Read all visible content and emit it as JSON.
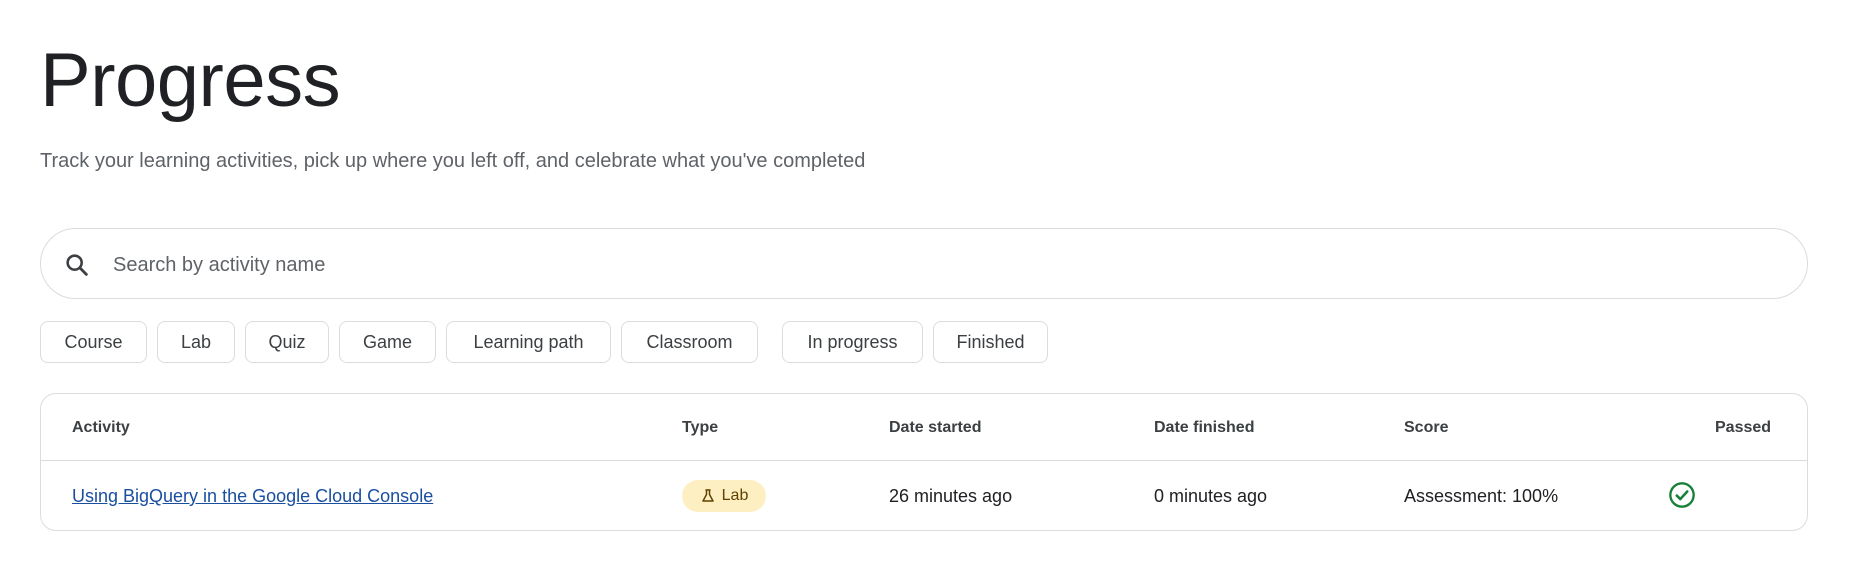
{
  "header": {
    "title": "Progress",
    "subtitle": "Track your learning activities, pick up where you left off, and celebrate what you've completed"
  },
  "search": {
    "placeholder": "Search by activity name",
    "value": "",
    "icon": "search-icon"
  },
  "filters": {
    "type_chips": [
      "Course",
      "Lab",
      "Quiz",
      "Game",
      "Learning path",
      "Classroom"
    ],
    "status_chips": [
      "In progress",
      "Finished"
    ]
  },
  "table": {
    "columns": [
      "Activity",
      "Type",
      "Date started",
      "Date finished",
      "Score",
      "Passed"
    ],
    "rows": [
      {
        "activity": "Using BigQuery in the Google Cloud Console",
        "type": "Lab",
        "type_icon": "flask-icon",
        "date_started": "26 minutes ago",
        "date_finished": "0 minutes ago",
        "score": "Assessment: 100%",
        "passed_icon": "check-circle-icon"
      }
    ]
  },
  "colors": {
    "badge_bg": "#feefc3",
    "link": "#1a4fa0",
    "passed": "#188038",
    "border": "#dadce0"
  }
}
